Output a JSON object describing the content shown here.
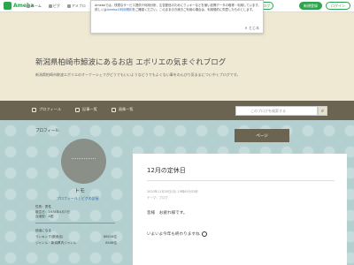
{
  "topbar": {
    "logo": "Ameba",
    "nav": [
      "ホーム",
      "ピグ",
      "アメブロ"
    ],
    "follow": "+ 人気ブログ",
    "register": "新規登録",
    "login": "ログイン"
  },
  "notice": {
    "text": "Amebaでは、快適なサービス提供や利用分析、広告配信のためにクッキーなどを使い訪問データの取得・利用しています。詳しくは",
    "link": "Amebaの利用規約",
    "text2": "をご確認ください。このまま引き続きご利用の場合は、利用規約に同意したものとします。",
    "close": "× とじる"
  },
  "header": {
    "title": "新潟県柏崎市鯨波にあるお店 エボリエの気まぐれブログ",
    "description": "新潟県柏崎市鯨波エボリエのオーナーシェフがどうでもいいようなどうでもよくない事をのんびり気ままについやくブログです。"
  },
  "menubar": {
    "items": [
      "プロフィール",
      "記事一覧",
      "画像一覧"
    ],
    "search_placeholder": "このブログを検索する"
  },
  "sidebar": {
    "heading": "プロフィール",
    "nickname": "トモ",
    "profile_link": "プロフィール | ピグの部屋",
    "info": [
      "性別：男性",
      "誕生日：1978年4月7日",
      "血液型：A型"
    ],
    "list": [
      {
        "label": "読者になる",
        "value": ""
      },
      {
        "label": "ランキング(飲食店)",
        "value": "86416位"
      },
      {
        "label": "ジャンル・新潟県内ジャンル",
        "value": "8448位"
      }
    ]
  },
  "toppage": "ページ",
  "article": {
    "title": "12月の定休日",
    "date": "2020年11月30日(月) 19時45分52秒",
    "theme": "テーマ：ブログ",
    "p1": "皆様　お疲れ様です。",
    "p2": "いよいよ今年も終わりますね"
  }
}
